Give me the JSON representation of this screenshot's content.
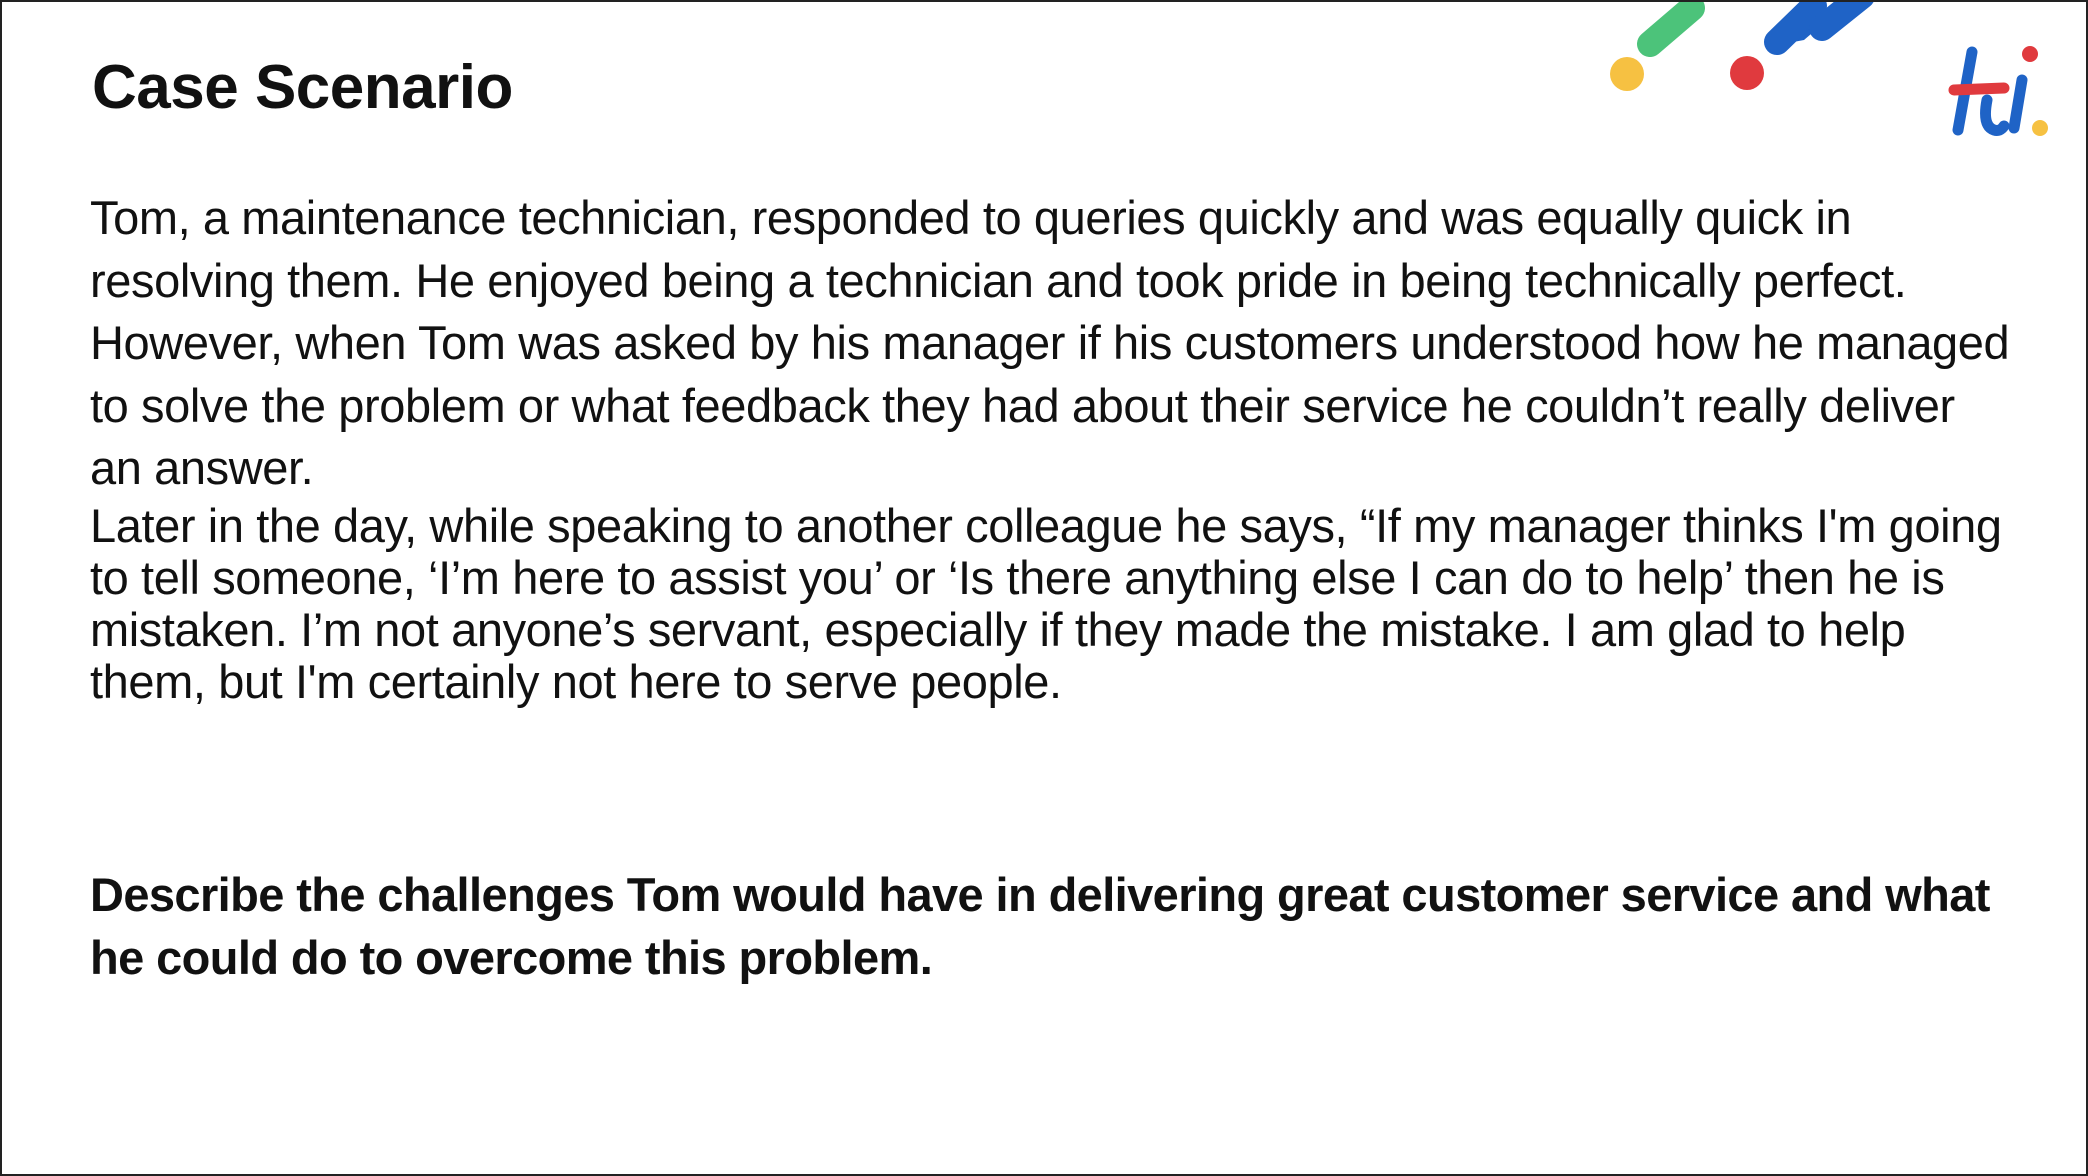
{
  "slide": {
    "title": "Case Scenario",
    "paragraphs": [
      "Tom, a maintenance technician, responded to queries quickly and was equally quick in resolving them. He enjoyed being a technician and took pride in being technically perfect. However, when Tom was asked by his manager if his customers understood how he managed to solve the problem or what feedback they had about their service he couldn’t really deliver an answer.",
      "Later in the day, while speaking to another colleague he  says, “If my manager thinks I'm going to tell someone, ‘I’m here to assist you’ or ‘Is there anything else I can do to help’ then he is mistaken. I’m not anyone’s servant, especially if they made the mistake. I am glad to help them, but I'm certainly not here to serve people."
    ],
    "question": "Describe the challenges Tom would have in delivering great customer service and what he could do to overcome this problem."
  },
  "branding": {
    "logo_icon": "hi-logo-icon",
    "decoration_icon": "colored-stripes-decoration",
    "colors": {
      "green": "#4cc37a",
      "yellow": "#f6c142",
      "red": "#e03a3e",
      "blue": "#1f63c6",
      "text": "#111111"
    }
  }
}
